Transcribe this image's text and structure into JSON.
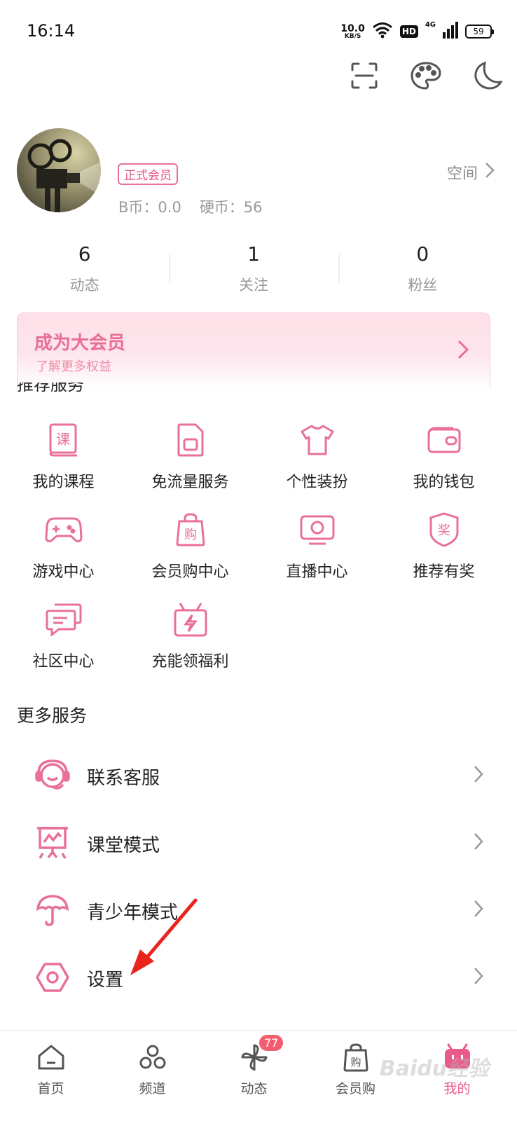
{
  "status_bar": {
    "time": "16:14",
    "net_speed_value": "10.0",
    "net_speed_unit": "KB/S",
    "hd_label": "HD",
    "signal_label": "4G",
    "battery": "59"
  },
  "profile": {
    "vip_tag": "正式会员",
    "bcoin": "B币：0.0",
    "coin": "硬币：56",
    "space_label": "空间"
  },
  "stats": [
    {
      "num": "6",
      "label": "动态"
    },
    {
      "num": "1",
      "label": "关注"
    },
    {
      "num": "0",
      "label": "粉丝"
    }
  ],
  "vip_banner": {
    "title": "成为大会员",
    "subtitle": "了解更多权益"
  },
  "recommended": {
    "title": "推荐服务",
    "items": [
      {
        "label": "我的课程",
        "icon": "course-icon"
      },
      {
        "label": "免流量服务",
        "icon": "sim-card-icon"
      },
      {
        "label": "个性装扮",
        "icon": "tshirt-icon"
      },
      {
        "label": "我的钱包",
        "icon": "wallet-icon"
      },
      {
        "label": "游戏中心",
        "icon": "gamepad-icon"
      },
      {
        "label": "会员购中心",
        "icon": "shopping-bag-icon"
      },
      {
        "label": "直播中心",
        "icon": "tv-icon"
      },
      {
        "label": "推荐有奖",
        "icon": "reward-badge-icon"
      },
      {
        "label": "社区中心",
        "icon": "chat-icon"
      },
      {
        "label": "充能领福利",
        "icon": "gift-bolt-icon"
      }
    ]
  },
  "more": {
    "title": "更多服务",
    "items": [
      {
        "label": "联系客服",
        "icon": "headset-icon"
      },
      {
        "label": "课堂模式",
        "icon": "classroom-board-icon"
      },
      {
        "label": "青少年模式",
        "icon": "umbrella-icon"
      },
      {
        "label": "设置",
        "icon": "settings-hex-icon"
      }
    ]
  },
  "bottom_nav": [
    {
      "label": "首页",
      "icon": "home-icon"
    },
    {
      "label": "频道",
      "icon": "channels-icon"
    },
    {
      "label": "动态",
      "icon": "pinwheel-icon",
      "badge": "77"
    },
    {
      "label": "会员购",
      "icon": "shopping-bag-icon"
    },
    {
      "label": "我的",
      "icon": "tv-mascot-icon"
    }
  ],
  "watermark": "Baidu经验",
  "colors": {
    "accent": "#ea5a8c",
    "icon_pink": "#e8709a",
    "banner_bg": "#fde0e8",
    "badge": "#f25d6f",
    "annotation_arrow": "#e8241c"
  }
}
